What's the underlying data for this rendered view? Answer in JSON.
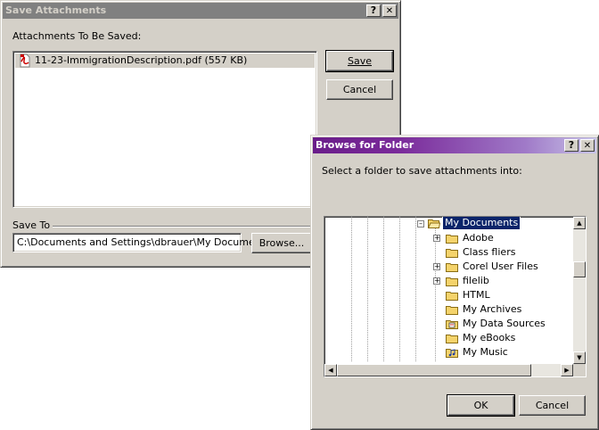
{
  "save_dialog": {
    "title": "Save Attachments",
    "help_glyph": "?",
    "close_glyph": "✕",
    "attachments_label": "Attachments To Be Saved:",
    "attachment_item": "11-23-ImmigrationDescription.pdf (557 KB)",
    "save_button": "Save",
    "cancel_button": "Cancel",
    "save_to_label": "Save To",
    "save_to_path": "C:\\Documents and Settings\\dbrauer\\My Documents",
    "browse_button": "Browse..."
  },
  "browse_dialog": {
    "title": "Browse for Folder",
    "help_glyph": "?",
    "close_glyph": "✕",
    "instruction": "Select a folder to save attachments into:",
    "tree": {
      "selected": "My Documents",
      "children": [
        {
          "label": "Adobe",
          "expandable": true
        },
        {
          "label": "Class fliers",
          "expandable": false
        },
        {
          "label": "Corel User Files",
          "expandable": true
        },
        {
          "label": "filelib",
          "expandable": true
        },
        {
          "label": "HTML",
          "expandable": false
        },
        {
          "label": "My Archives",
          "expandable": false
        },
        {
          "label": "My Data Sources",
          "expandable": false
        },
        {
          "label": "My eBooks",
          "expandable": false
        },
        {
          "label": "My Music",
          "expandable": false
        }
      ]
    },
    "ok_button": "OK",
    "cancel_button": "Cancel"
  },
  "colors": {
    "face": "#d4d0c8",
    "active_title_start": "#6a1d8a",
    "active_title_end": "#c8c4e8",
    "inactive_title": "#808080",
    "selection": "#0a246a",
    "folder_yellow": "#f4d36b"
  }
}
